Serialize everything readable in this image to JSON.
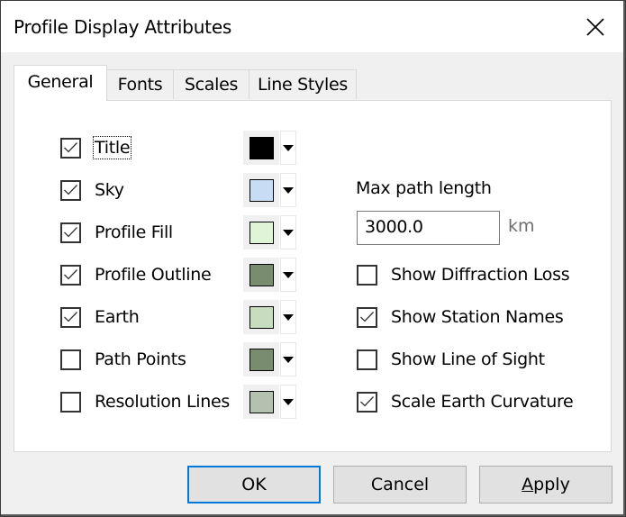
{
  "window": {
    "title": "Profile Display Attributes",
    "close_icon": "close-x-icon"
  },
  "tabs": [
    {
      "label": "General",
      "active": true
    },
    {
      "label": "Fonts",
      "active": false
    },
    {
      "label": "Scales",
      "active": false
    },
    {
      "label": "Line Styles",
      "active": false
    }
  ],
  "general": {
    "display_items": [
      {
        "label": "Title",
        "checked": true,
        "color": "#000000",
        "focused": true
      },
      {
        "label": "Sky",
        "checked": true,
        "color": "#c8dcf4"
      },
      {
        "label": "Profile Fill",
        "checked": true,
        "color": "#e0f4d8"
      },
      {
        "label": "Profile Outline",
        "checked": true,
        "color": "#7a8c70"
      },
      {
        "label": "Earth",
        "checked": true,
        "color": "#c8dcc0"
      },
      {
        "label": "Path Points",
        "checked": false,
        "color": "#7a8c70"
      },
      {
        "label": "Resolution Lines",
        "checked": false,
        "color": "#b4c0b0"
      }
    ],
    "max_path_length": {
      "label": "Max path length",
      "value": "3000.0",
      "unit": "km"
    },
    "options": [
      {
        "label": "Show Diffraction Loss",
        "checked": false
      },
      {
        "label": "Show Station Names",
        "checked": true
      },
      {
        "label": "Show Line of Sight",
        "checked": false
      },
      {
        "label": "Scale Earth Curvature",
        "checked": true
      }
    ]
  },
  "buttons": {
    "ok": "OK",
    "cancel": "Cancel",
    "apply_mnemonic": "A",
    "apply_rest": "pply"
  },
  "colors": {
    "accent": "#0078d7",
    "dialog_bg": "#f0f0f0"
  }
}
